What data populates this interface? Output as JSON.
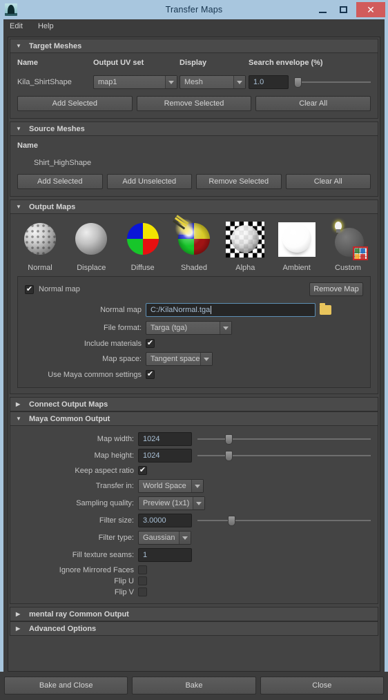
{
  "window": {
    "title": "Transfer Maps",
    "icon": "maya-app-icon",
    "minimize": "–",
    "maximize": "□",
    "close": "✕"
  },
  "menubar": {
    "items": [
      {
        "label": "Edit"
      },
      {
        "label": "Help"
      }
    ]
  },
  "sections": {
    "target_meshes": {
      "title": "Target Meshes",
      "expanded": true,
      "columns": [
        "Name",
        "Output UV set",
        "Display",
        "Search envelope (%)"
      ],
      "rows": [
        {
          "name": "Kila_ShirtShape",
          "uv_set": "map1",
          "display": "Mesh",
          "search_envelope": "1.0",
          "slider_percent": 2
        }
      ],
      "buttons": [
        "Add Selected",
        "Remove Selected",
        "Clear All"
      ]
    },
    "source_meshes": {
      "title": "Source Meshes",
      "expanded": true,
      "columns": [
        "Name"
      ],
      "rows": [
        {
          "name": "Shirt_HighShape"
        }
      ],
      "buttons": [
        "Add Selected",
        "Add Unselected",
        "Remove Selected",
        "Clear All"
      ]
    },
    "output_maps": {
      "title": "Output Maps",
      "expanded": true,
      "maps": [
        {
          "label": "Normal",
          "icon": "normal-map-sphere-icon"
        },
        {
          "label": "Displace",
          "icon": "displace-map-sphere-icon"
        },
        {
          "label": "Diffuse",
          "icon": "diffuse-map-sphere-icon"
        },
        {
          "label": "Shaded",
          "icon": "shaded-map-sphere-icon"
        },
        {
          "label": "Alpha",
          "icon": "alpha-map-sphere-icon"
        },
        {
          "label": "Ambient",
          "icon": "ambient-map-sphere-icon"
        },
        {
          "label": "Custom",
          "icon": "custom-map-sphere-icon"
        }
      ],
      "detail": {
        "enabled_label": "Normal map",
        "enabled_checked": "✔",
        "remove_map_label": "Remove Map",
        "fields": {
          "normal_map_label": "Normal map",
          "normal_map_value": "C:/KilaNormal.tga",
          "file_format_label": "File format:",
          "file_format_value": "Targa (tga)",
          "include_materials_label": "Include materials",
          "include_materials_checked": "✔",
          "map_space_label": "Map space:",
          "map_space_value": "Tangent space",
          "use_maya_common_label": "Use Maya common settings",
          "use_maya_common_checked": "✔"
        }
      }
    },
    "connect_output_maps": {
      "title": "Connect Output Maps",
      "expanded": false
    },
    "maya_common_output": {
      "title": "Maya Common Output",
      "expanded": true,
      "map_width_label": "Map width:",
      "map_width_value": "1024",
      "map_width_slider_percent": 25,
      "map_height_label": "Map height:",
      "map_height_value": "1024",
      "map_height_slider_percent": 25,
      "keep_aspect_label": "Keep aspect ratio",
      "keep_aspect_checked": "✔",
      "transfer_in_label": "Transfer in:",
      "transfer_in_value": "World Space",
      "sampling_quality_label": "Sampling quality:",
      "sampling_quality_value": "Preview (1x1)",
      "filter_size_label": "Filter size:",
      "filter_size_value": "3.0000",
      "filter_size_slider_percent": 28,
      "filter_type_label": "Filter type:",
      "filter_type_value": "Gaussian",
      "fill_texture_seams_label": "Fill texture seams:",
      "fill_texture_seams_value": "1",
      "ignore_mirrored_label": "Ignore Mirrored Faces",
      "ignore_mirrored_checked": "",
      "flip_u_label": "Flip U",
      "flip_u_checked": "",
      "flip_v_label": "Flip V",
      "flip_v_checked": ""
    },
    "mental_ray_common_output": {
      "title": "mental ray Common Output",
      "expanded": false
    },
    "advanced_options": {
      "title": "Advanced Options",
      "expanded": false
    }
  },
  "footer": {
    "buttons": [
      {
        "label": "Bake and Close"
      },
      {
        "label": "Bake"
      },
      {
        "label": "Close"
      }
    ]
  },
  "colors": {
    "window_frame": "#a8c6de",
    "panel_bg": "#444444",
    "header_bg": "#4a4a4a",
    "field_bg": "#2b2b2b",
    "field_text": "#a9c0d6",
    "close_button": "#d15b5b",
    "focus_border": "#5d8fb5"
  },
  "icons": {
    "expanded_arrow": "▼",
    "collapsed_arrow": "▶"
  }
}
